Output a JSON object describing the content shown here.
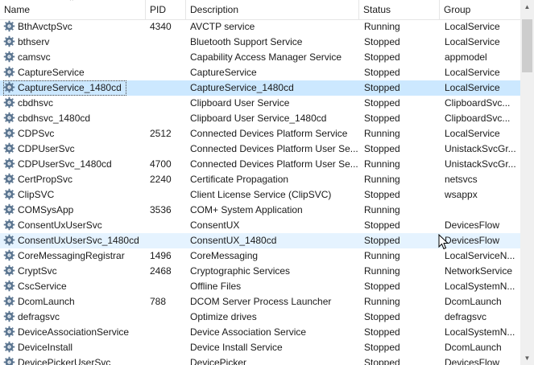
{
  "columns": {
    "name": "Name",
    "pid": "PID",
    "description": "Description",
    "status": "Status",
    "group": "Group"
  },
  "sort": {
    "column": "name",
    "direction": "ascending",
    "icon": "sort-up-arrow"
  },
  "selected_row": "CaptureService_1480cd",
  "hovered_row": "ConsentUxUserSvc_1480cd",
  "colors": {
    "selected": "#cce8ff",
    "hover": "#e5f3ff",
    "gear": "#5b7590"
  },
  "rows": [
    {
      "name": "BthAvctpSvc",
      "pid": "4340",
      "description": "AVCTP service",
      "status": "Running",
      "group": "LocalService"
    },
    {
      "name": "bthserv",
      "pid": "",
      "description": "Bluetooth Support Service",
      "status": "Stopped",
      "group": "LocalService"
    },
    {
      "name": "camsvc",
      "pid": "",
      "description": "Capability Access Manager Service",
      "status": "Stopped",
      "group": "appmodel"
    },
    {
      "name": "CaptureService",
      "pid": "",
      "description": "CaptureService",
      "status": "Stopped",
      "group": "LocalService"
    },
    {
      "name": "CaptureService_1480cd",
      "pid": "",
      "description": "CaptureService_1480cd",
      "status": "Stopped",
      "group": "LocalService"
    },
    {
      "name": "cbdhsvc",
      "pid": "",
      "description": "Clipboard User Service",
      "status": "Stopped",
      "group": "ClipboardSvc..."
    },
    {
      "name": "cbdhsvc_1480cd",
      "pid": "",
      "description": "Clipboard User Service_1480cd",
      "status": "Stopped",
      "group": "ClipboardSvc..."
    },
    {
      "name": "CDPSvc",
      "pid": "2512",
      "description": "Connected Devices Platform Service",
      "status": "Running",
      "group": "LocalService"
    },
    {
      "name": "CDPUserSvc",
      "pid": "",
      "description": "Connected Devices Platform User Se...",
      "status": "Stopped",
      "group": "UnistackSvcGr..."
    },
    {
      "name": "CDPUserSvc_1480cd",
      "pid": "4700",
      "description": "Connected Devices Platform User Se...",
      "status": "Running",
      "group": "UnistackSvcGr..."
    },
    {
      "name": "CertPropSvc",
      "pid": "2240",
      "description": "Certificate Propagation",
      "status": "Running",
      "group": "netsvcs"
    },
    {
      "name": "ClipSVC",
      "pid": "",
      "description": "Client License Service (ClipSVC)",
      "status": "Stopped",
      "group": "wsappx"
    },
    {
      "name": "COMSysApp",
      "pid": "3536",
      "description": "COM+ System Application",
      "status": "Running",
      "group": ""
    },
    {
      "name": "ConsentUxUserSvc",
      "pid": "",
      "description": "ConsentUX",
      "status": "Stopped",
      "group": "DevicesFlow"
    },
    {
      "name": "ConsentUxUserSvc_1480cd",
      "pid": "",
      "description": "ConsentUX_1480cd",
      "status": "Stopped",
      "group": "DevicesFlow"
    },
    {
      "name": "CoreMessagingRegistrar",
      "pid": "1496",
      "description": "CoreMessaging",
      "status": "Running",
      "group": "LocalServiceN..."
    },
    {
      "name": "CryptSvc",
      "pid": "2468",
      "description": "Cryptographic Services",
      "status": "Running",
      "group": "NetworkService"
    },
    {
      "name": "CscService",
      "pid": "",
      "description": "Offline Files",
      "status": "Stopped",
      "group": "LocalSystemN..."
    },
    {
      "name": "DcomLaunch",
      "pid": "788",
      "description": "DCOM Server Process Launcher",
      "status": "Running",
      "group": "DcomLaunch"
    },
    {
      "name": "defragsvc",
      "pid": "",
      "description": "Optimize drives",
      "status": "Stopped",
      "group": "defragsvc"
    },
    {
      "name": "DeviceAssociationService",
      "pid": "",
      "description": "Device Association Service",
      "status": "Stopped",
      "group": "LocalSystemN..."
    },
    {
      "name": "DeviceInstall",
      "pid": "",
      "description": "Device Install Service",
      "status": "Stopped",
      "group": "DcomLaunch"
    },
    {
      "name": "DevicePickerUserSvc",
      "pid": "",
      "description": "DevicePicker",
      "status": "Stopped",
      "group": "DevicesFlow"
    }
  ]
}
